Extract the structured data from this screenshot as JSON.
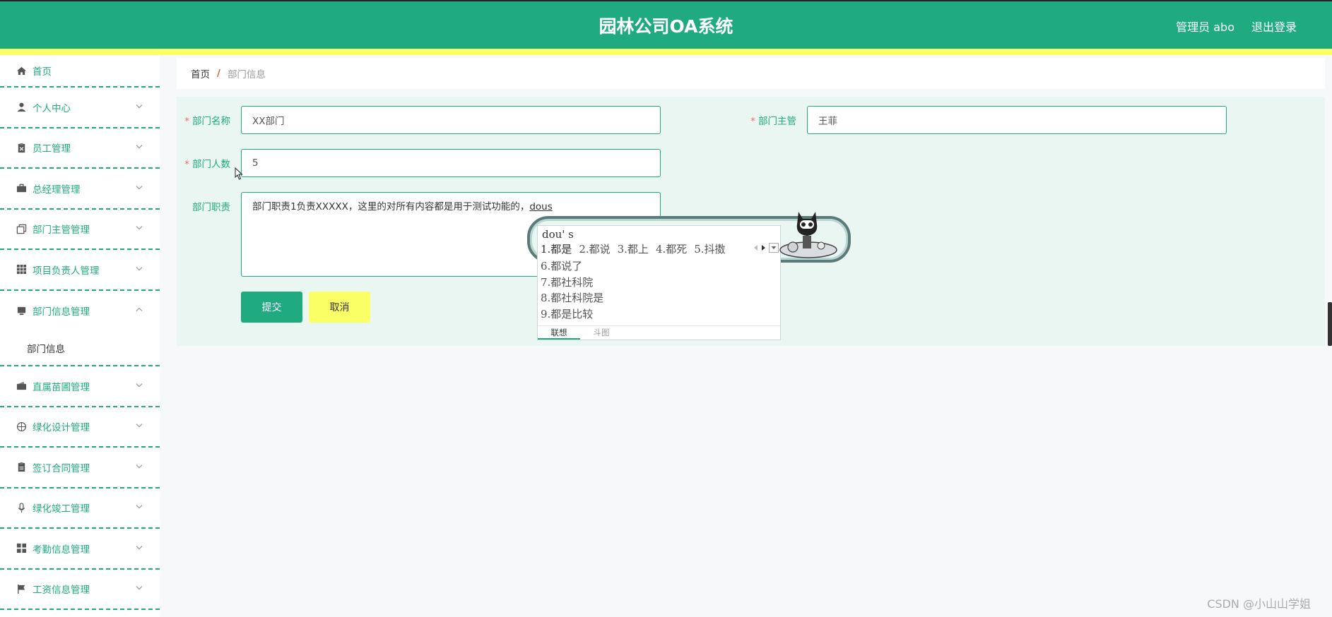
{
  "header": {
    "title": "园林公司OA系统",
    "user": "管理员 abo",
    "logout": "退出登录"
  },
  "sidebar": {
    "items": [
      {
        "label": "首页",
        "icon": "home-icon"
      },
      {
        "label": "个人中心",
        "icon": "user-icon"
      },
      {
        "label": "员工管理",
        "icon": "clipboard-icon"
      },
      {
        "label": "总经理管理",
        "icon": "briefcase-icon"
      },
      {
        "label": "部门主管管理",
        "icon": "copy-icon"
      },
      {
        "label": "项目负责人管理",
        "icon": "grid-icon"
      },
      {
        "label": "部门信息管理",
        "icon": "monitor-icon",
        "expanded": true
      },
      {
        "label": "直属苗圃管理",
        "icon": "wallet-icon"
      },
      {
        "label": "绿化设计管理",
        "icon": "compass-icon"
      },
      {
        "label": "签订合同管理",
        "icon": "clipboard-list-icon"
      },
      {
        "label": "绿化竣工管理",
        "icon": "microphone-icon"
      },
      {
        "label": "考勤信息管理",
        "icon": "apps-icon"
      },
      {
        "label": "工资信息管理",
        "icon": "flag-icon"
      }
    ],
    "subitem": "部门信息"
  },
  "breadcrumb": {
    "home": "首页",
    "separator": "/",
    "current": "部门信息"
  },
  "form": {
    "dept_name_label": "部门名称",
    "dept_name_value": "XX部门",
    "dept_head_label": "部门主管",
    "dept_head_value": "王菲",
    "dept_count_label": "部门人数",
    "dept_count_value": "5",
    "dept_duty_label": "部门职责",
    "dept_duty_value": "部门职责1负责XXXXX，这里的对所有内容都是用于测试功能的，",
    "dept_duty_composing": "dous",
    "required_mark": "*",
    "submit": "提交",
    "cancel": "取消"
  },
  "ime": {
    "pinyin": "dou' s",
    "row1": [
      "1.都是",
      "2.都说",
      "3.都上",
      "4.都死",
      "5.抖擞"
    ],
    "more": [
      "6.都说了",
      "7.都社科院",
      "8.都社科院是",
      "9.都是比较"
    ],
    "tabs": [
      "联想",
      "斗图"
    ]
  },
  "watermark": "CSDN @小山山学姐",
  "colors": {
    "primary": "#1fab7f",
    "accent": "#fbff66",
    "required": "#f56c6c"
  }
}
